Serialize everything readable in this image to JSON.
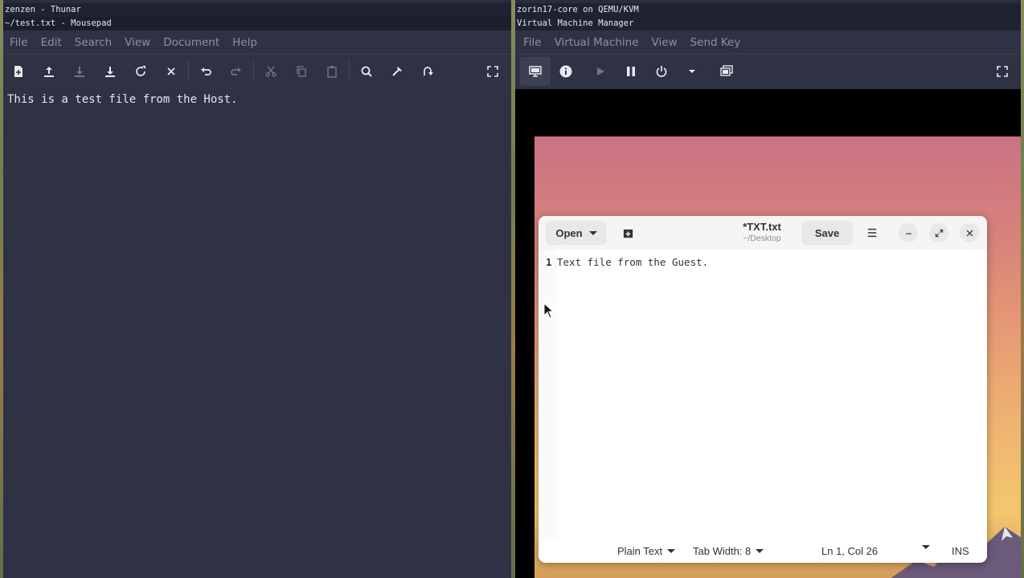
{
  "left_window": {
    "wm_title_1": "zenzen - Thunar",
    "wm_title_2": "~/test.txt - Mousepad",
    "menu": [
      "File",
      "Edit",
      "Search",
      "View",
      "Document",
      "Help"
    ],
    "editor_text": "This is a test file from the Host."
  },
  "right_window": {
    "wm_title_1": "zorin17-core on QEMU/KVM",
    "wm_title_2": "Virtual Machine Manager",
    "menu": [
      "File",
      "Virtual Machine",
      "View",
      "Send Key"
    ]
  },
  "gedit": {
    "open_label": "Open",
    "title": "*TXT.txt",
    "subtitle": "~/Desktop",
    "save_label": "Save",
    "line_number": "1",
    "line_text": "Text file from the Guest.",
    "status": {
      "language": "Plain Text",
      "tab_width": "Tab Width: 8",
      "position": "Ln 1, Col 26",
      "mode": "INS"
    }
  },
  "colors": {
    "dark_bg": "#2e3244",
    "menu_text": "#8b91a3",
    "guest_gradient_top": "#c97285",
    "guest_gradient_bottom": "#f3c76e"
  }
}
